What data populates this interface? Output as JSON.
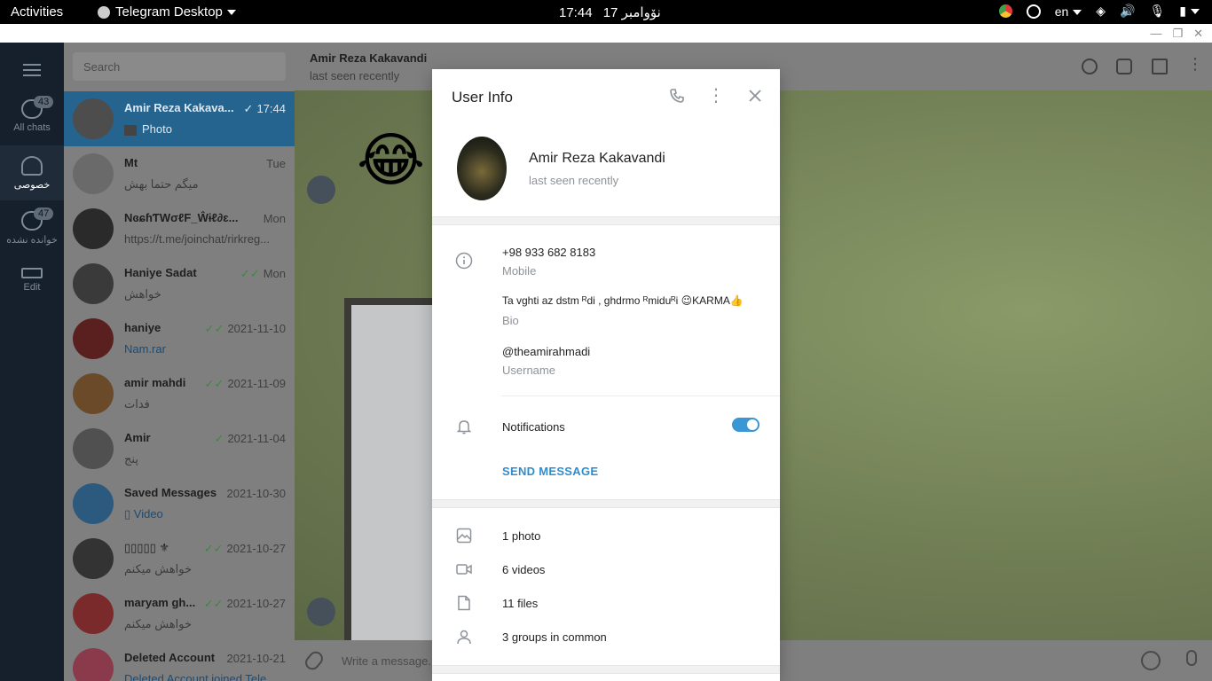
{
  "topbar": {
    "activities": "Activities",
    "app_name": "Telegram Desktop",
    "time": "17:44",
    "date": "17 نۆوامبر",
    "language": "en"
  },
  "rail": {
    "all_chats": {
      "label": "All chats",
      "badge": "43"
    },
    "personal": {
      "label": "خصوصی"
    },
    "unread": {
      "label": "خوانده نشده",
      "badge": "47"
    },
    "edit": {
      "label": "Edit"
    }
  },
  "chatlist": {
    "search_placeholder": "Search",
    "chats": [
      {
        "name": "Amir Reza Kakava...",
        "time": "17:44",
        "msg": "Photo",
        "checked": true
      },
      {
        "name": "Mt",
        "time": "Tue",
        "msg": "میگم حتما بهش"
      },
      {
        "name": "NɞɕɦƬWσℓF_Ŵɨℓ∂ɛ...",
        "time": "Mon",
        "msg": "https://t.me/joinchat/rirkreg..."
      },
      {
        "name": "Haniye Sadat",
        "time": "Mon",
        "msg": "خواهش",
        "checked": true
      },
      {
        "name": "haniye",
        "time": "2021-11-10",
        "msg": "Nam.rar",
        "checked": true
      },
      {
        "name": "amir mahdi",
        "time": "2021-11-09",
        "msg": "فدات",
        "checked": true
      },
      {
        "name": "Amir",
        "time": "2021-11-04",
        "msg": "پنج",
        "checked": true
      },
      {
        "name": "Saved Messages",
        "time": "2021-10-30",
        "msg": "Video"
      },
      {
        "name": "▯▯▯▯▯ ⚜",
        "time": "2021-10-27",
        "msg": "خواهش میکنم",
        "checked": true
      },
      {
        "name": "maryam gh...",
        "time": "2021-10-27",
        "msg": "خواهش میکنم",
        "checked": true
      },
      {
        "name": "Deleted Account",
        "time": "2021-10-21",
        "msg": "Deleted Account joined Tele..."
      }
    ]
  },
  "chat_header": {
    "name": "Amir Reza Kakavandi",
    "status": "last seen recently"
  },
  "composer": {
    "placeholder": "Write a message..."
  },
  "user_info": {
    "title": "User Info",
    "name": "Amir Reza Kakavandi",
    "status": "last seen recently",
    "phone": "+98 933 682 8183",
    "phone_label": "Mobile",
    "bio": "Ta vghti az dstm ᴿdi , ghdrmo ᴿmiduᴿi 😉KARMA👍",
    "bio_label": "Bio",
    "username": "@theamirahmadi",
    "username_label": "Username",
    "notifications": "Notifications",
    "notifications_on": true,
    "send_message": "SEND MESSAGE",
    "media": {
      "photos": "1 photo",
      "videos": "6 videos",
      "files": "11 files",
      "groups": "3 groups in common"
    }
  },
  "colors": {
    "accent": "#3a97d6",
    "selected_chat": "#25648f",
    "link": "#2e8dcf"
  }
}
